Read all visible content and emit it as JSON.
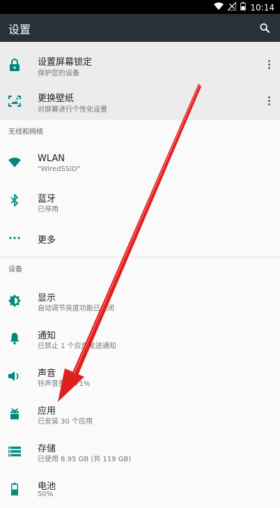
{
  "status_bar": {
    "time": "10:14"
  },
  "app_bar": {
    "title": "设置"
  },
  "suggestions": [
    {
      "title": "设置屏幕锁定",
      "subtitle": "保护您的设备",
      "icon": "lock-icon"
    },
    {
      "title": "更换壁纸",
      "subtitle": "对屏幕进行个性化设置",
      "icon": "wallpaper-icon"
    }
  ],
  "sections": {
    "wireless": {
      "header": "无线和网络",
      "items": [
        {
          "title": "WLAN",
          "subtitle": "\"WiredSSID\"",
          "icon": "wifi-icon"
        },
        {
          "title": "蓝牙",
          "subtitle": "已停用",
          "icon": "bluetooth-icon"
        },
        {
          "title": "更多",
          "icon": "more-horiz-icon"
        }
      ]
    },
    "device": {
      "header": "设备",
      "items": [
        {
          "title": "显示",
          "subtitle": "自动调节亮度功能已关闭",
          "icon": "display-icon"
        },
        {
          "title": "通知",
          "subtitle": "已禁止 1 个应用发送通知",
          "icon": "bell-icon"
        },
        {
          "title": "声音",
          "subtitle": "铃声音量为 71%",
          "icon": "volume-icon"
        },
        {
          "title": "应用",
          "subtitle": "已安装 30 个应用",
          "icon": "android-icon"
        },
        {
          "title": "存储",
          "subtitle": "已使用 8.95 GB (共 119 GB)",
          "icon": "storage-icon"
        },
        {
          "title": "电池",
          "subtitle": "50%",
          "icon": "battery-icon"
        }
      ]
    }
  },
  "colors": {
    "accent": "#00897b",
    "app_bar": "#263238",
    "annotation_arrow": "#e02020"
  }
}
